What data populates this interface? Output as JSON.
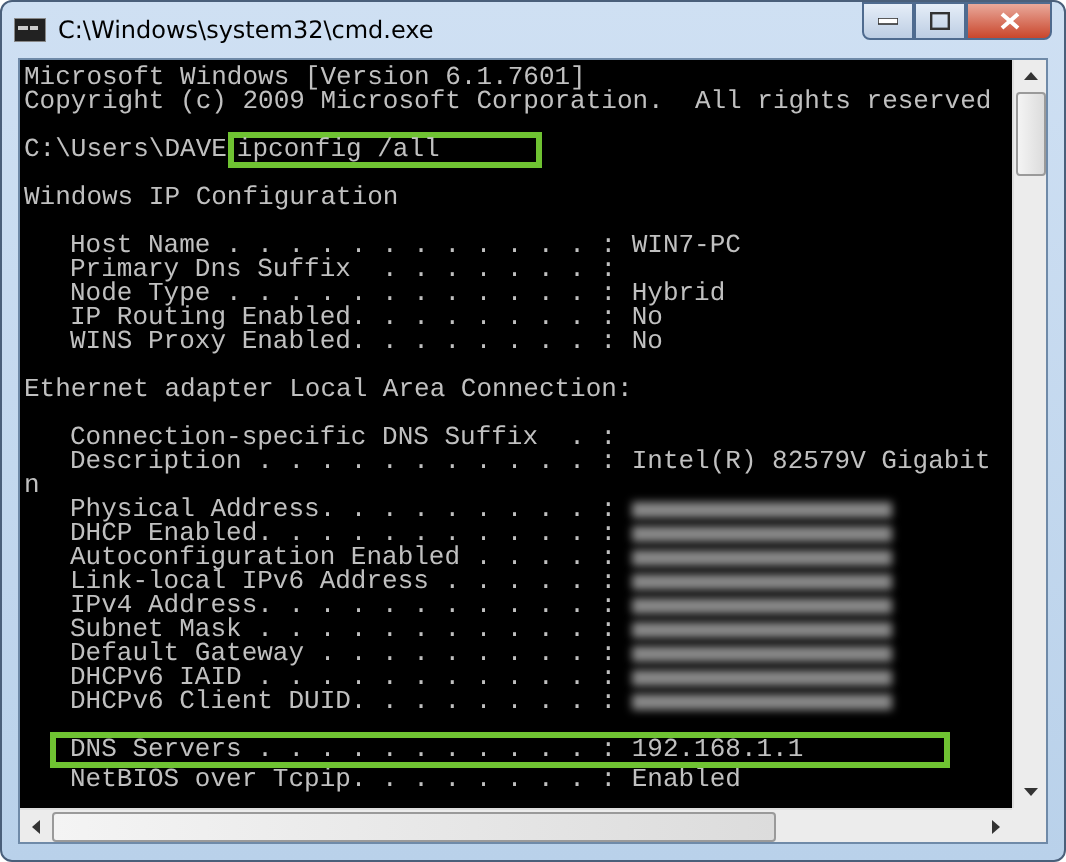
{
  "window": {
    "title": "C:\\Windows\\system32\\cmd.exe"
  },
  "lines": [
    {
      "kind": "text",
      "text": "Microsoft Windows [Version 6.1.7601]"
    },
    {
      "kind": "text",
      "text": "Copyright (c) 2009 Microsoft Corporation.  All rights reserved"
    },
    {
      "kind": "blank"
    },
    {
      "kind": "prompt",
      "prompt": "C:\\Users\\DAVE",
      "command": "ipconfig /all",
      "highlighted": true
    },
    {
      "kind": "blank"
    },
    {
      "kind": "text",
      "text": "Windows IP Configuration"
    },
    {
      "kind": "blank"
    },
    {
      "kind": "field",
      "text": "Host Name . . . . . . . . . . . . : WIN7-PC",
      "blurred": false,
      "highlighted": false
    },
    {
      "kind": "field",
      "text": "Primary Dns Suffix  . . . . . . . :",
      "blurred": false,
      "highlighted": false
    },
    {
      "kind": "field",
      "text": "Node Type . . . . . . . . . . . . : Hybrid",
      "blurred": false,
      "highlighted": false
    },
    {
      "kind": "field",
      "text": "IP Routing Enabled. . . . . . . . : No",
      "blurred": false,
      "highlighted": false
    },
    {
      "kind": "field",
      "text": "WINS Proxy Enabled. . . . . . . . : No",
      "blurred": false,
      "highlighted": false
    },
    {
      "kind": "blank"
    },
    {
      "kind": "text",
      "text": "Ethernet adapter Local Area Connection:"
    },
    {
      "kind": "blank"
    },
    {
      "kind": "field",
      "text": "Connection-specific DNS Suffix  . :",
      "blurred": false,
      "highlighted": false
    },
    {
      "kind": "field",
      "text": "Description . . . . . . . . . . . : Intel(R) 82579V Gigabit",
      "blurred": false,
      "highlighted": false
    },
    {
      "kind": "text",
      "text": "n"
    },
    {
      "kind": "field",
      "text": "Physical Address. . . . . . . . . :",
      "blurred": true,
      "highlighted": false
    },
    {
      "kind": "field",
      "text": "DHCP Enabled. . . . . . . . . . . :",
      "blurred": true,
      "highlighted": false
    },
    {
      "kind": "field",
      "text": "Autoconfiguration Enabled . . . . :",
      "blurred": true,
      "highlighted": false
    },
    {
      "kind": "field",
      "text": "Link-local IPv6 Address . . . . . :",
      "blurred": true,
      "highlighted": false
    },
    {
      "kind": "field",
      "text": "IPv4 Address. . . . . . . . . . . :",
      "blurred": true,
      "highlighted": false
    },
    {
      "kind": "field",
      "text": "Subnet Mask . . . . . . . . . . . :",
      "blurred": true,
      "highlighted": false
    },
    {
      "kind": "field",
      "text": "Default Gateway . . . . . . . . . :",
      "blurred": true,
      "highlighted": false
    },
    {
      "kind": "field",
      "text": "DHCPv6 IAID . . . . . . . . . . . :",
      "blurred": true,
      "highlighted": false
    },
    {
      "kind": "field",
      "text": "DHCPv6 Client DUID. . . . . . . . :",
      "blurred": true,
      "highlighted": false
    },
    {
      "kind": "blank"
    },
    {
      "kind": "field",
      "text": "DNS Servers . . . . . . . . . . . : 192.168.1.1",
      "blurred": false,
      "highlighted": true
    },
    {
      "kind": "field",
      "text": "NetBIOS over Tcpip. . . . . . . . : Enabled",
      "blurred": false,
      "highlighted": false
    }
  ]
}
